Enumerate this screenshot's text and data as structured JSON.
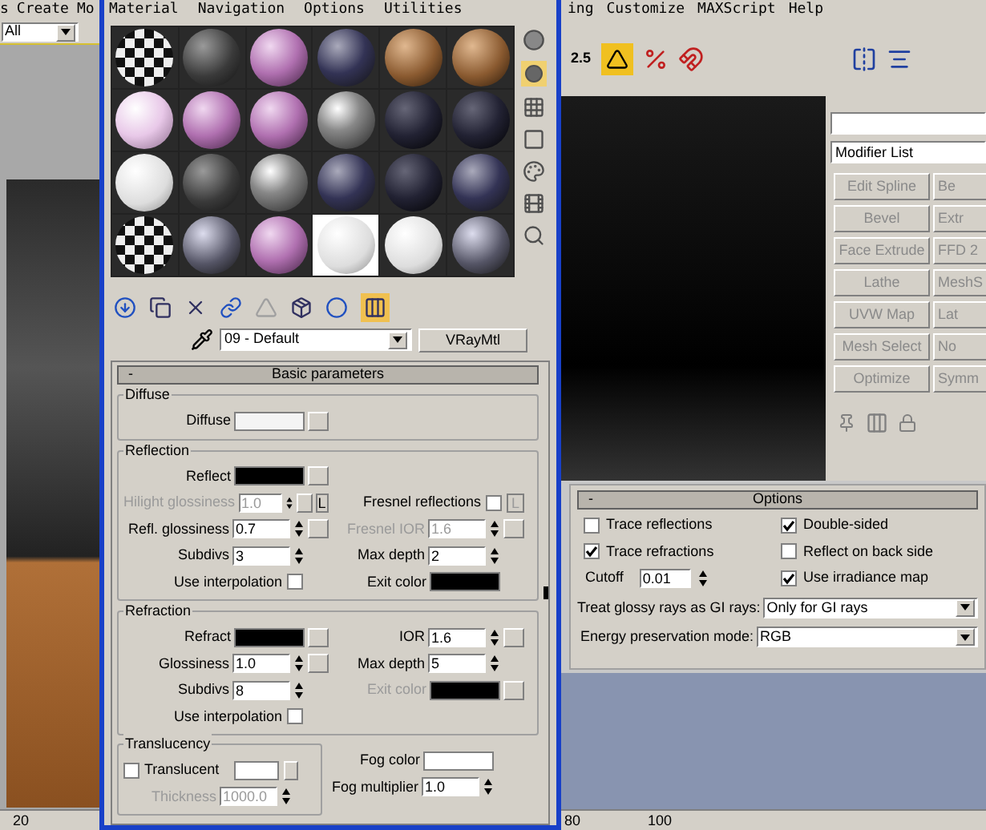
{
  "app_menu_left": [
    "s",
    "Create",
    "Mo"
  ],
  "app_menu_right": [
    "ing",
    "Customize",
    "MAXScript",
    "Help"
  ],
  "viewport_filter": "All",
  "toolbar_readout": "2.5",
  "ruler_labels": [
    "20",
    "80",
    "100"
  ],
  "material_editor": {
    "menu": [
      "Material",
      "Navigation",
      "Options",
      "Utilities"
    ],
    "material_name": "09 - Default",
    "material_type": "VRayMtl",
    "rollout": {
      "collapse": "-",
      "title": "Basic parameters"
    },
    "groups": [
      {
        "title": "Diffuse",
        "rows": [
          [
            {
              "kind": "swatch",
              "label": "Diffuse",
              "color": "#f4f4f4",
              "map": true,
              "disabled": false
            }
          ]
        ]
      },
      {
        "title": "Reflection",
        "rows": [
          [
            {
              "kind": "swatch",
              "label": "Reflect",
              "color": "#000000",
              "map": true,
              "disabled": false
            }
          ],
          [
            {
              "kind": "spinner",
              "label": "Hilight glossiness",
              "value": "1.0",
              "map": true,
              "lock": "L",
              "disabled": true
            },
            {
              "kind": "checkbox",
              "label": "Fresnel reflections",
              "checked": false,
              "lock": "L",
              "disabled": false
            }
          ],
          [
            {
              "kind": "spinner",
              "label": "Refl. glossiness",
              "value": "0.7",
              "map": true,
              "disabled": false
            },
            {
              "kind": "spinner",
              "label": "Fresnel IOR",
              "value": "1.6",
              "map": true,
              "disabled": true
            }
          ],
          [
            {
              "kind": "spinner",
              "label": "Subdivs",
              "value": "3",
              "map": false,
              "disabled": false
            },
            {
              "kind": "spinner",
              "label": "Max depth",
              "value": "2",
              "map": false,
              "disabled": false
            }
          ],
          [
            {
              "kind": "checkbox",
              "label": "Use interpolation",
              "checked": false,
              "disabled": false
            },
            {
              "kind": "swatch",
              "label": "Exit color",
              "color": "#000000",
              "map": false,
              "disabled": false
            }
          ]
        ]
      },
      {
        "title": "Refraction",
        "rows": [
          [
            {
              "kind": "swatch",
              "label": "Refract",
              "color": "#000000",
              "map": true,
              "disabled": false
            },
            {
              "kind": "spinner",
              "label": "IOR",
              "value": "1.6",
              "map": true,
              "disabled": false
            }
          ],
          [
            {
              "kind": "spinner",
              "label": "Glossiness",
              "value": "1.0",
              "map": true,
              "disabled": false
            },
            {
              "kind": "spinner",
              "label": "Max depth",
              "value": "5",
              "map": false,
              "disabled": false
            }
          ],
          [
            {
              "kind": "spinner",
              "label": "Subdivs",
              "value": "8",
              "map": false,
              "disabled": false
            },
            {
              "kind": "swatch",
              "label": "Exit color",
              "color": "#000000",
              "map": true,
              "disabled": true
            }
          ],
          [
            {
              "kind": "checkbox",
              "label": "Use interpolation",
              "checked": false,
              "disabled": false
            }
          ]
        ]
      }
    ],
    "translucency": {
      "title": "Translucency",
      "rows": [
        [
          {
            "kind": "checkbox",
            "label": "Translucent",
            "checked": false,
            "color": "#ffffff",
            "map": true,
            "disabled": false
          }
        ],
        [
          {
            "kind": "spinner",
            "label": "Thickness",
            "value": "1000.0",
            "map": false,
            "disabled": true
          }
        ]
      ]
    },
    "fog_rows": [
      [
        {
          "kind": "swatch",
          "label": "Fog color",
          "color": "#ffffff",
          "map": false,
          "disabled": false
        }
      ],
      [
        {
          "kind": "spinner",
          "label": "Fog multiplier",
          "value": "1.0",
          "map": false,
          "disabled": false
        }
      ]
    ]
  },
  "options": {
    "collapse": "-",
    "title": "Options",
    "checkboxes_left": [
      {
        "label": "Trace reflections",
        "checked": false
      },
      {
        "label": "Trace refractions",
        "checked": true
      }
    ],
    "cutoff": {
      "label": "Cutoff",
      "value": "0.01"
    },
    "checkboxes_right": [
      {
        "label": "Double-sided",
        "checked": true
      },
      {
        "label": "Reflect on back side",
        "checked": false
      },
      {
        "label": "Use irradiance map",
        "checked": true
      }
    ],
    "dropdowns": [
      {
        "label": "Treat glossy rays as GI rays:",
        "value": "Only for GI rays"
      },
      {
        "label": "Energy preservation mode:",
        "value": "RGB"
      }
    ]
  },
  "modifier_list": "Modifier List",
  "modifier_buttons": [
    "Edit Spline",
    "Be",
    "Bevel",
    "Extr",
    "Face Extrude",
    "FFD 2",
    "Lathe",
    "MeshS",
    "UVW Map",
    "Lat",
    "Mesh Select",
    "No",
    "Optimize",
    "Symm"
  ]
}
